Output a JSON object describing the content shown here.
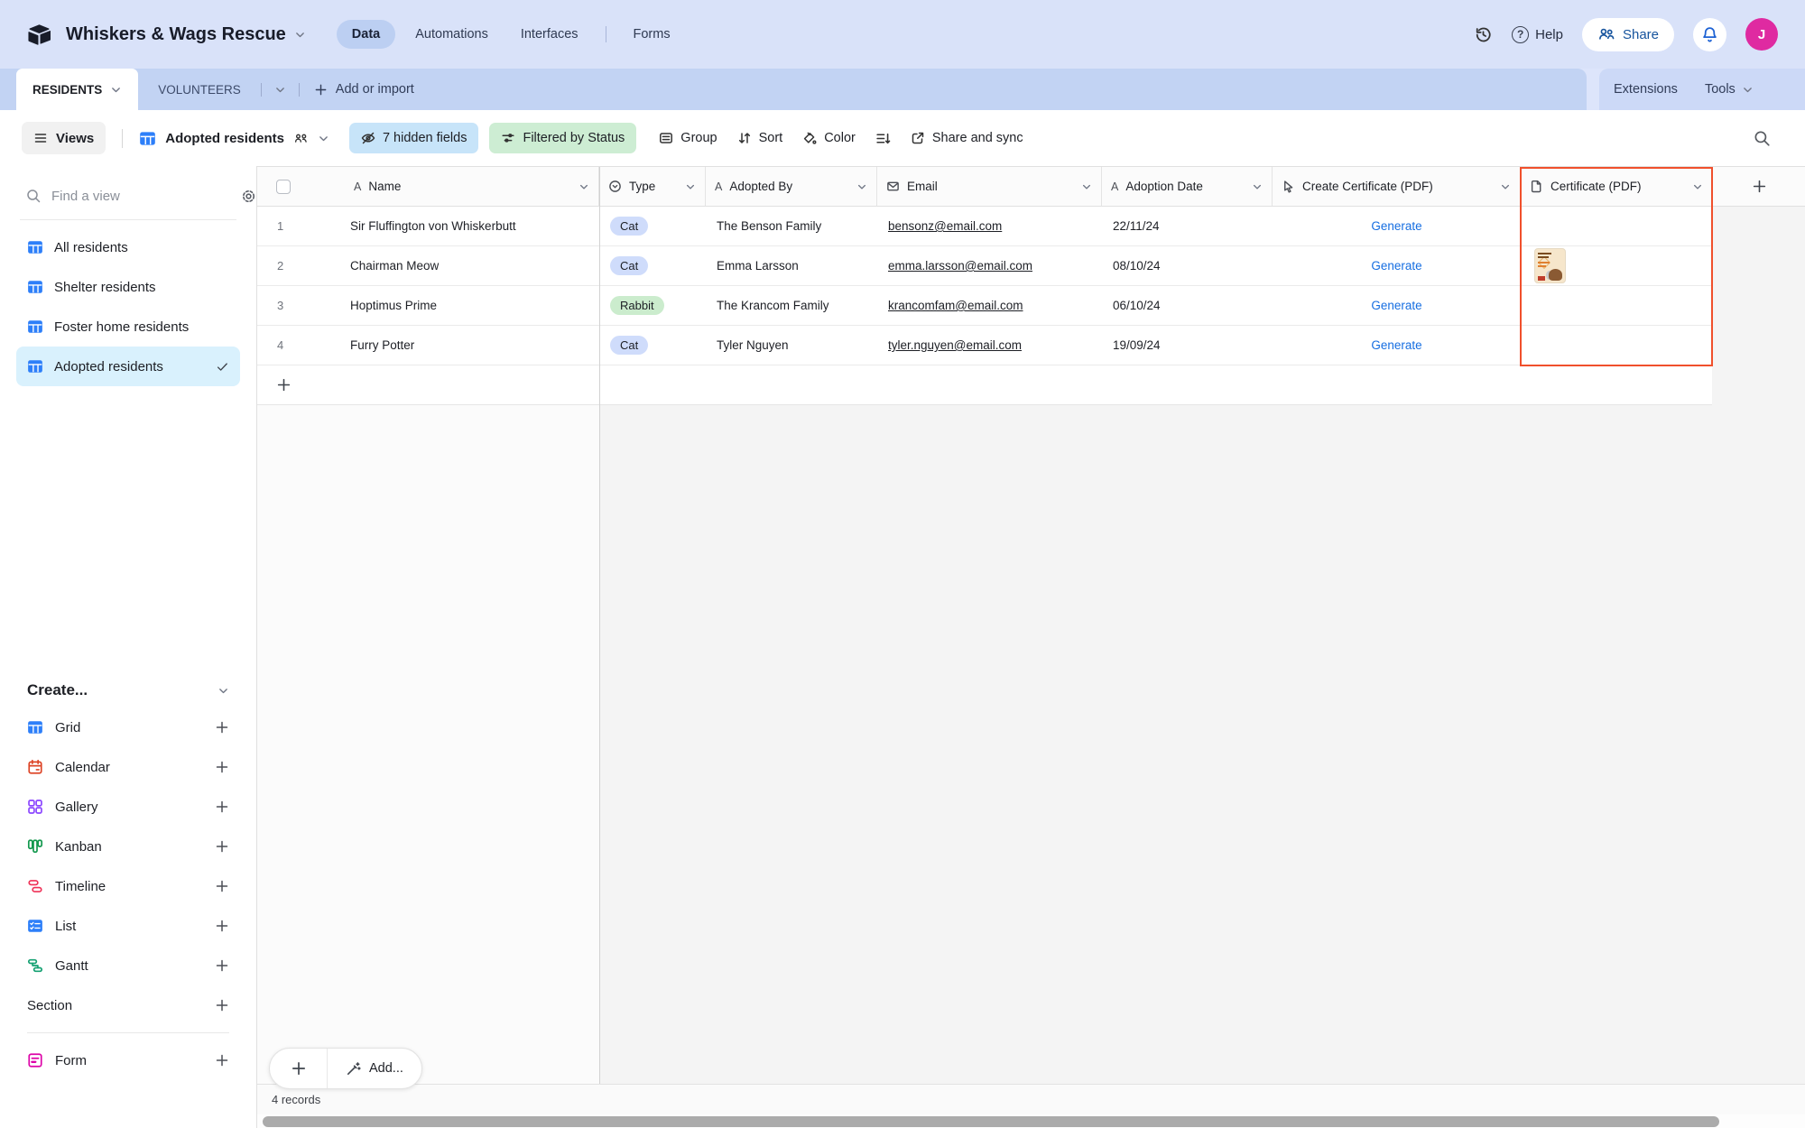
{
  "topbar": {
    "workspace_title": "Whiskers & Wags Rescue",
    "nav_data": "Data",
    "nav_automations": "Automations",
    "nav_interfaces": "Interfaces",
    "nav_forms": "Forms",
    "help_label": "Help",
    "share_label": "Share",
    "avatar_initial": "J"
  },
  "tabbar": {
    "tab_residents": "RESIDENTS",
    "tab_volunteers": "VOLUNTEERS",
    "add_or_import": "Add or import",
    "extensions": "Extensions",
    "tools": "Tools"
  },
  "toolbar": {
    "views": "Views",
    "view_name": "Adopted residents",
    "hidden_fields": "7 hidden fields",
    "filtered": "Filtered by Status",
    "group": "Group",
    "sort": "Sort",
    "color": "Color",
    "share_sync": "Share and sync"
  },
  "sidebar": {
    "find_placeholder": "Find a view",
    "views": [
      {
        "label": "All residents"
      },
      {
        "label": "Shelter residents"
      },
      {
        "label": "Foster home residents"
      },
      {
        "label": "Adopted residents",
        "active": true
      }
    ],
    "create_label": "Create...",
    "create_items": [
      {
        "label": "Grid"
      },
      {
        "label": "Calendar"
      },
      {
        "label": "Gallery"
      },
      {
        "label": "Kanban"
      },
      {
        "label": "Timeline"
      },
      {
        "label": "List"
      },
      {
        "label": "Gantt"
      },
      {
        "label": "Section"
      },
      {
        "label": "Form"
      }
    ]
  },
  "grid": {
    "headers": {
      "name": "Name",
      "type": "Type",
      "adopted_by": "Adopted By",
      "email": "Email",
      "adoption_date": "Adoption Date",
      "create_certificate": "Create Certificate (PDF)",
      "certificate": "Certificate (PDF)"
    },
    "rows": [
      {
        "num": "1",
        "name": "Sir Fluffington von Whiskerbutt",
        "type": "Cat",
        "type_color": "#cfdcfb",
        "adopted_by": "The Benson Family",
        "email": "bensonz@email.com",
        "date": "22/11/24",
        "action": "Generate",
        "attachment": ""
      },
      {
        "num": "2",
        "name": "Chairman Meow",
        "type": "Cat",
        "type_color": "#cfdcfb",
        "adopted_by": "Emma Larsson",
        "email": "emma.larsson@email.com",
        "date": "08/10/24",
        "action": "Generate",
        "attachment": "certificate-thumbnail"
      },
      {
        "num": "3",
        "name": "Hoptimus Prime",
        "type": "Rabbit",
        "type_color": "#cbeccd",
        "adopted_by": "The Krancom Family",
        "email": "krancomfam@email.com",
        "date": "06/10/24",
        "action": "Generate",
        "attachment": ""
      },
      {
        "num": "4",
        "name": "Furry Potter",
        "type": "Cat",
        "type_color": "#cfdcfb",
        "adopted_by": "Tyler Nguyen",
        "email": "tyler.nguyen@email.com",
        "date": "19/09/24",
        "action": "Generate",
        "attachment": ""
      }
    ],
    "record_count": "4 records",
    "add_label": "Add..."
  },
  "colors": {
    "accent_blue": "#166ee1",
    "grid_icon_blue": "#2d7ff9",
    "highlight_red": "#f0502c",
    "topbar_bg": "#d9e2f9"
  }
}
